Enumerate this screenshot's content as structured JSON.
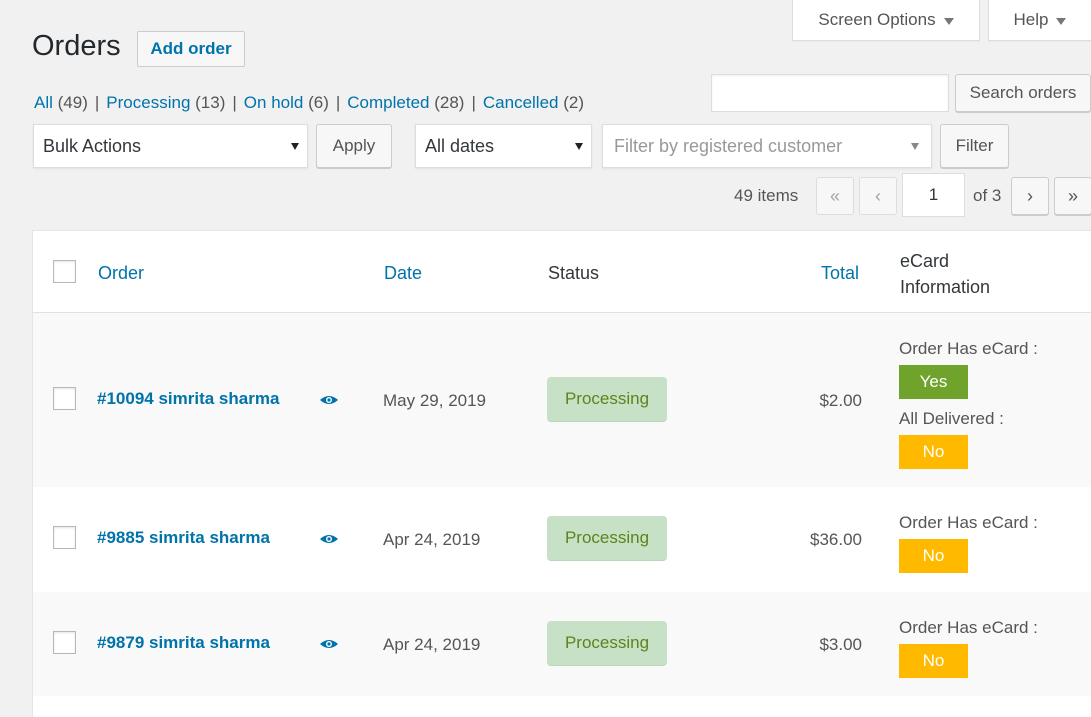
{
  "top_tabs": {
    "screen_options": "Screen Options",
    "help": "Help"
  },
  "header": {
    "title": "Orders",
    "add_order": "Add order"
  },
  "status_filters": [
    {
      "label": "All",
      "count": "(49)"
    },
    {
      "label": "Processing",
      "count": "(13)"
    },
    {
      "label": "On hold",
      "count": "(6)"
    },
    {
      "label": "Completed",
      "count": "(28)"
    },
    {
      "label": "Cancelled",
      "count": "(2)"
    }
  ],
  "search": {
    "value": "",
    "button": "Search orders"
  },
  "toolbar": {
    "bulk_actions": "Bulk Actions",
    "apply": "Apply",
    "dates": "All dates",
    "customer_placeholder": "Filter by registered customer",
    "filter": "Filter"
  },
  "pagination": {
    "items": "49 items",
    "first": "«",
    "prev": "‹",
    "current": "1",
    "of": "of 3",
    "next": "›",
    "last": "»"
  },
  "table": {
    "columns": {
      "order": "Order",
      "date": "Date",
      "status": "Status",
      "total": "Total",
      "ecard": "eCard Information"
    },
    "rows": [
      {
        "order": "#10094 simrita sharma",
        "date": "May 29, 2019",
        "status": "Processing",
        "total": "$2.00",
        "ecard_label": "Order Has eCard :",
        "ecard_value": "Yes",
        "delivered_label": "All Delivered :",
        "delivered_value": "No"
      },
      {
        "order": "#9885 simrita sharma",
        "date": "Apr 24, 2019",
        "status": "Processing",
        "total": "$36.00",
        "ecard_label": "Order Has eCard :",
        "ecard_value": "No"
      },
      {
        "order": "#9879 simrita sharma",
        "date": "Apr 24, 2019",
        "status": "Processing",
        "total": "$3.00",
        "ecard_label": "Order Has eCard :",
        "ecard_value": "No"
      }
    ]
  },
  "colors": {
    "link": "#0073aa",
    "status_processing_bg": "#c6e1c6",
    "status_processing_text": "#5b841b",
    "badge_yes": "#6fa32b",
    "badge_no": "#ffba00"
  }
}
